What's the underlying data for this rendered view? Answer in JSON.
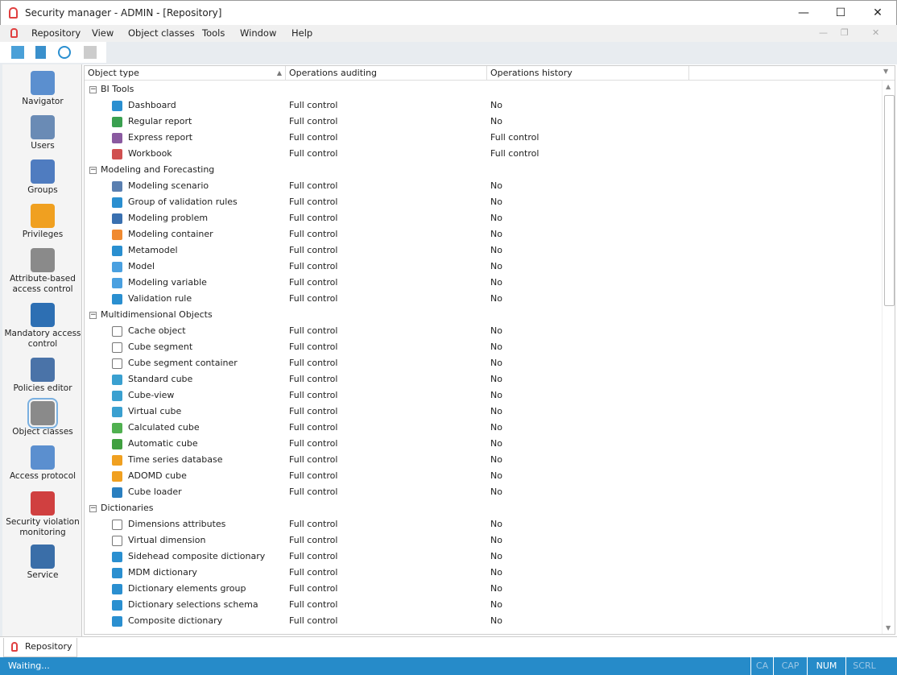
{
  "window": {
    "title": "Security manager - ADMIN - [Repository]",
    "minimize": "—",
    "maximize": "☐",
    "close": "✕"
  },
  "menu": [
    "Repository",
    "View",
    "Object classes",
    "Tools",
    "Window",
    "Help"
  ],
  "sidebar": [
    {
      "label": "Navigator",
      "color": "#5b8fcf"
    },
    {
      "label": "Users",
      "color": "#6a8bb5"
    },
    {
      "label": "Groups",
      "color": "#4f7cc0"
    },
    {
      "label": "Privileges",
      "color": "#f0a020"
    },
    {
      "label": "Attribute-based access control",
      "color": "#8a8a8a"
    },
    {
      "label": "Mandatory access control",
      "color": "#2d6fb3"
    },
    {
      "label": "Policies editor",
      "color": "#4a73a8"
    },
    {
      "label": "Object classes",
      "color": "#8a8a8a"
    },
    {
      "label": "Access protocol",
      "color": "#5b8fcf"
    },
    {
      "label": "Security violation monitoring",
      "color": "#d04040"
    },
    {
      "label": "Service",
      "color": "#3a6ea8"
    }
  ],
  "grid": {
    "columns": [
      "Object type",
      "Operations auditing",
      "Operations history"
    ],
    "rows": [
      {
        "group": "BI Tools"
      },
      {
        "name": "Dashboard",
        "audit": "Full control",
        "history": "No",
        "color": "#2a8fd0"
      },
      {
        "name": "Regular report",
        "audit": "Full control",
        "history": "No",
        "color": "#3aa050"
      },
      {
        "name": "Express report",
        "audit": "Full control",
        "history": "Full control",
        "color": "#8a5aa0"
      },
      {
        "name": "Workbook",
        "audit": "Full control",
        "history": "Full control",
        "color": "#d05050"
      },
      {
        "group": "Modeling and Forecasting"
      },
      {
        "name": "Modeling scenario",
        "audit": "Full control",
        "history": "No",
        "color": "#5a7fb0"
      },
      {
        "name": "Group of validation rules",
        "audit": "Full control",
        "history": "No",
        "color": "#2a8fd0"
      },
      {
        "name": "Modeling problem",
        "audit": "Full control",
        "history": "No",
        "color": "#3a70b0"
      },
      {
        "name": "Modeling container",
        "audit": "Full control",
        "history": "No",
        "color": "#f08a30"
      },
      {
        "name": "Metamodel",
        "audit": "Full control",
        "history": "No",
        "color": "#2a8fd0"
      },
      {
        "name": "Model",
        "audit": "Full control",
        "history": "No",
        "color": "#4aa0e0"
      },
      {
        "name": "Modeling variable",
        "audit": "Full control",
        "history": "No",
        "color": "#4aa0e0"
      },
      {
        "name": "Validation rule",
        "audit": "Full control",
        "history": "No",
        "color": "#2a8fd0"
      },
      {
        "group": "Multidimensional Objects"
      },
      {
        "name": "Cache object",
        "audit": "Full control",
        "history": "No",
        "color": "#ffffff"
      },
      {
        "name": "Cube segment",
        "audit": "Full control",
        "history": "No",
        "color": "#ffffff"
      },
      {
        "name": "Cube segment container",
        "audit": "Full control",
        "history": "No",
        "color": "#ffffff"
      },
      {
        "name": "Standard cube",
        "audit": "Full control",
        "history": "No",
        "color": "#3aa0d0"
      },
      {
        "name": "Cube-view",
        "audit": "Full control",
        "history": "No",
        "color": "#3aa0d0"
      },
      {
        "name": "Virtual cube",
        "audit": "Full control",
        "history": "No",
        "color": "#3aa0d0"
      },
      {
        "name": "Calculated cube",
        "audit": "Full control",
        "history": "No",
        "color": "#50b050"
      },
      {
        "name": "Automatic cube",
        "audit": "Full control",
        "history": "No",
        "color": "#40a040"
      },
      {
        "name": "Time series database",
        "audit": "Full control",
        "history": "No",
        "color": "#f0a020"
      },
      {
        "name": "ADOMD cube",
        "audit": "Full control",
        "history": "No",
        "color": "#f0a020"
      },
      {
        "name": "Cube loader",
        "audit": "Full control",
        "history": "No",
        "color": "#2a7fc0"
      },
      {
        "group": "Dictionaries"
      },
      {
        "name": "Dimensions attributes",
        "audit": "Full control",
        "history": "No",
        "color": "#ffffff"
      },
      {
        "name": "Virtual dimension",
        "audit": "Full control",
        "history": "No",
        "color": "#ffffff"
      },
      {
        "name": "Sidehead composite dictionary",
        "audit": "Full control",
        "history": "No",
        "color": "#2a8fd0"
      },
      {
        "name": "MDM dictionary",
        "audit": "Full control",
        "history": "No",
        "color": "#2a8fd0"
      },
      {
        "name": "Dictionary elements group",
        "audit": "Full control",
        "history": "No",
        "color": "#2a8fd0"
      },
      {
        "name": "Dictionary selections schema",
        "audit": "Full control",
        "history": "No",
        "color": "#2a8fd0"
      },
      {
        "name": "Composite dictionary",
        "audit": "Full control",
        "history": "No",
        "color": "#2a8fd0"
      }
    ]
  },
  "tab": {
    "label": "Repository"
  },
  "status": {
    "text": "Waiting...",
    "panels": [
      "CA",
      "CAP",
      "NUM",
      "SCRL"
    ]
  }
}
